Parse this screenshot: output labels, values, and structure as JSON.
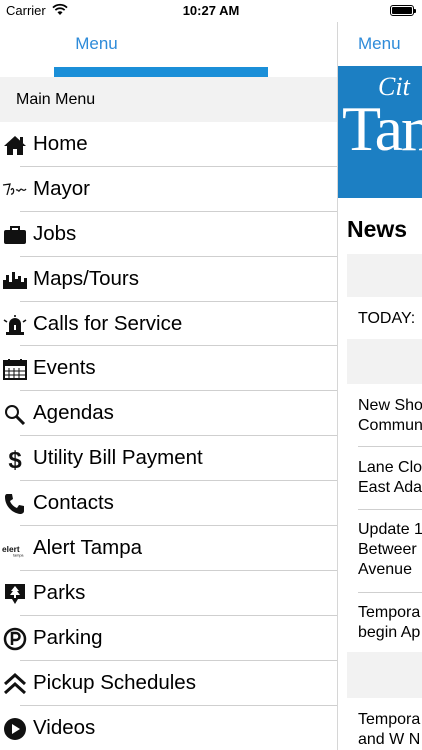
{
  "status_bar": {
    "carrier": "Carrier",
    "time": "10:27 AM"
  },
  "drawer": {
    "nav_title": "Menu",
    "section_header": "Main Menu",
    "items": [
      {
        "label": "Home",
        "icon": "home-icon"
      },
      {
        "label": "Mayor",
        "icon": "mayor-signature-icon"
      },
      {
        "label": "Jobs",
        "icon": "briefcase-icon"
      },
      {
        "label": "Maps/Tours",
        "icon": "skyline-icon"
      },
      {
        "label": "Calls for Service",
        "icon": "siren-icon"
      },
      {
        "label": "Events",
        "icon": "calendar-icon"
      },
      {
        "label": "Agendas",
        "icon": "magnifier-icon"
      },
      {
        "label": "Utility Bill Payment",
        "icon": "dollar-icon"
      },
      {
        "label": "Contacts",
        "icon": "phone-icon"
      },
      {
        "label": "Alert Tampa",
        "icon": "alert-tampa-logo-icon"
      },
      {
        "label": "Parks",
        "icon": "park-sign-icon"
      },
      {
        "label": "Parking",
        "icon": "parking-icon"
      },
      {
        "label": "Pickup Schedules",
        "icon": "double-chevron-up-icon"
      },
      {
        "label": "Videos",
        "icon": "play-icon"
      }
    ]
  },
  "content": {
    "nav_button": "Menu",
    "banner_city": "Cit",
    "banner_name": "Tam",
    "news_title": "News",
    "today_label": "TODAY:",
    "news_items": [
      {
        "line1": "New Sho",
        "line2": "Commun"
      },
      {
        "line1": "Lane Clo",
        "line2": "East Ada"
      },
      {
        "line1": "Update 1",
        "line2": "Betweer",
        "line3": "Avenue"
      },
      {
        "line1": "Tempora",
        "line2": "begin Ap"
      },
      {
        "line1": "Tempora",
        "line2": "and W N"
      }
    ]
  },
  "colors": {
    "accent": "#2e8bd9",
    "banner": "#1c7fc3",
    "band": "#f2f2f2"
  }
}
